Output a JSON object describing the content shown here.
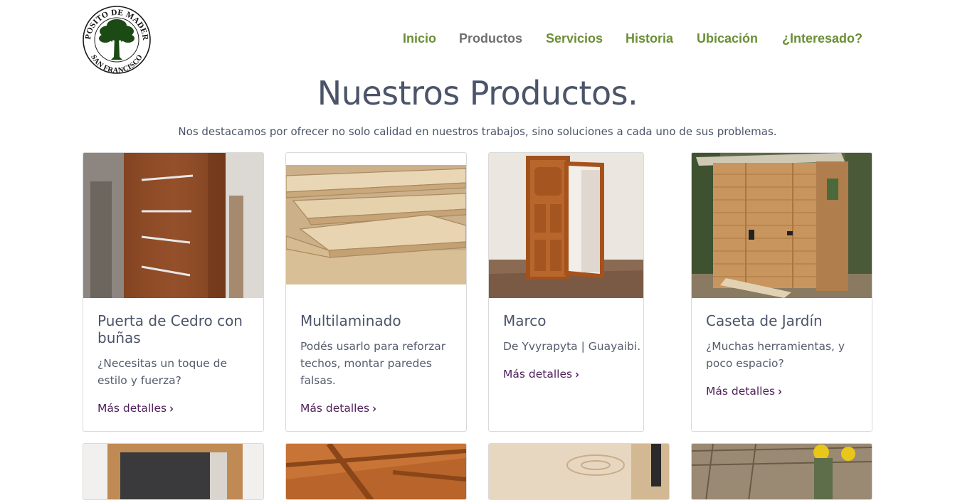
{
  "brand": {
    "logo_text_top": "DEPOSITO DE MADERAS",
    "logo_text_bottom": "SAN FRANCISCO",
    "logo_icon": "tree-icon"
  },
  "nav": {
    "items": [
      {
        "label": "Inicio",
        "active": false
      },
      {
        "label": "Productos",
        "active": true
      },
      {
        "label": "Servicios",
        "active": false
      },
      {
        "label": "Historia",
        "active": false
      },
      {
        "label": "Ubicación",
        "active": false
      },
      {
        "label": "¿Interesado?",
        "active": false
      }
    ],
    "color": "#6a8f36",
    "active_color": "#6f6f6f"
  },
  "main": {
    "title": "Nuestros Productos.",
    "subtitle": "Nos destacamos por ofrecer no solo calidad en nuestros trabajos, sino soluciones a cada uno de sus problemas.",
    "more_label": "Más detalles",
    "more_icon": "chevron-right-icon",
    "cards": [
      {
        "title": "Puerta de Cedro con buñas",
        "description": "¿Necesitas un toque de estilo y fuerza?",
        "image": "cedar-door-image"
      },
      {
        "title": "Multilaminado",
        "description": "Podés usarlo para reforzar techos, montar paredes falsas.",
        "image": "plywood-image"
      },
      {
        "title": "Marco",
        "description": "De Yvyrapyta | Guayaibi.",
        "image": "door-frame-image"
      },
      {
        "title": "Caseta de Jardín",
        "description": "¿Muchas herramientas, y poco espacio?",
        "image": "garden-shed-image"
      }
    ],
    "second_row_images": [
      "door-frame-closeup-image",
      "wood-ceiling-image",
      "wood-planks-image",
      "construction-workers-image"
    ]
  },
  "colors": {
    "title": "#4b5468",
    "link": "#4f1f5a",
    "border": "#d9d9d9"
  }
}
